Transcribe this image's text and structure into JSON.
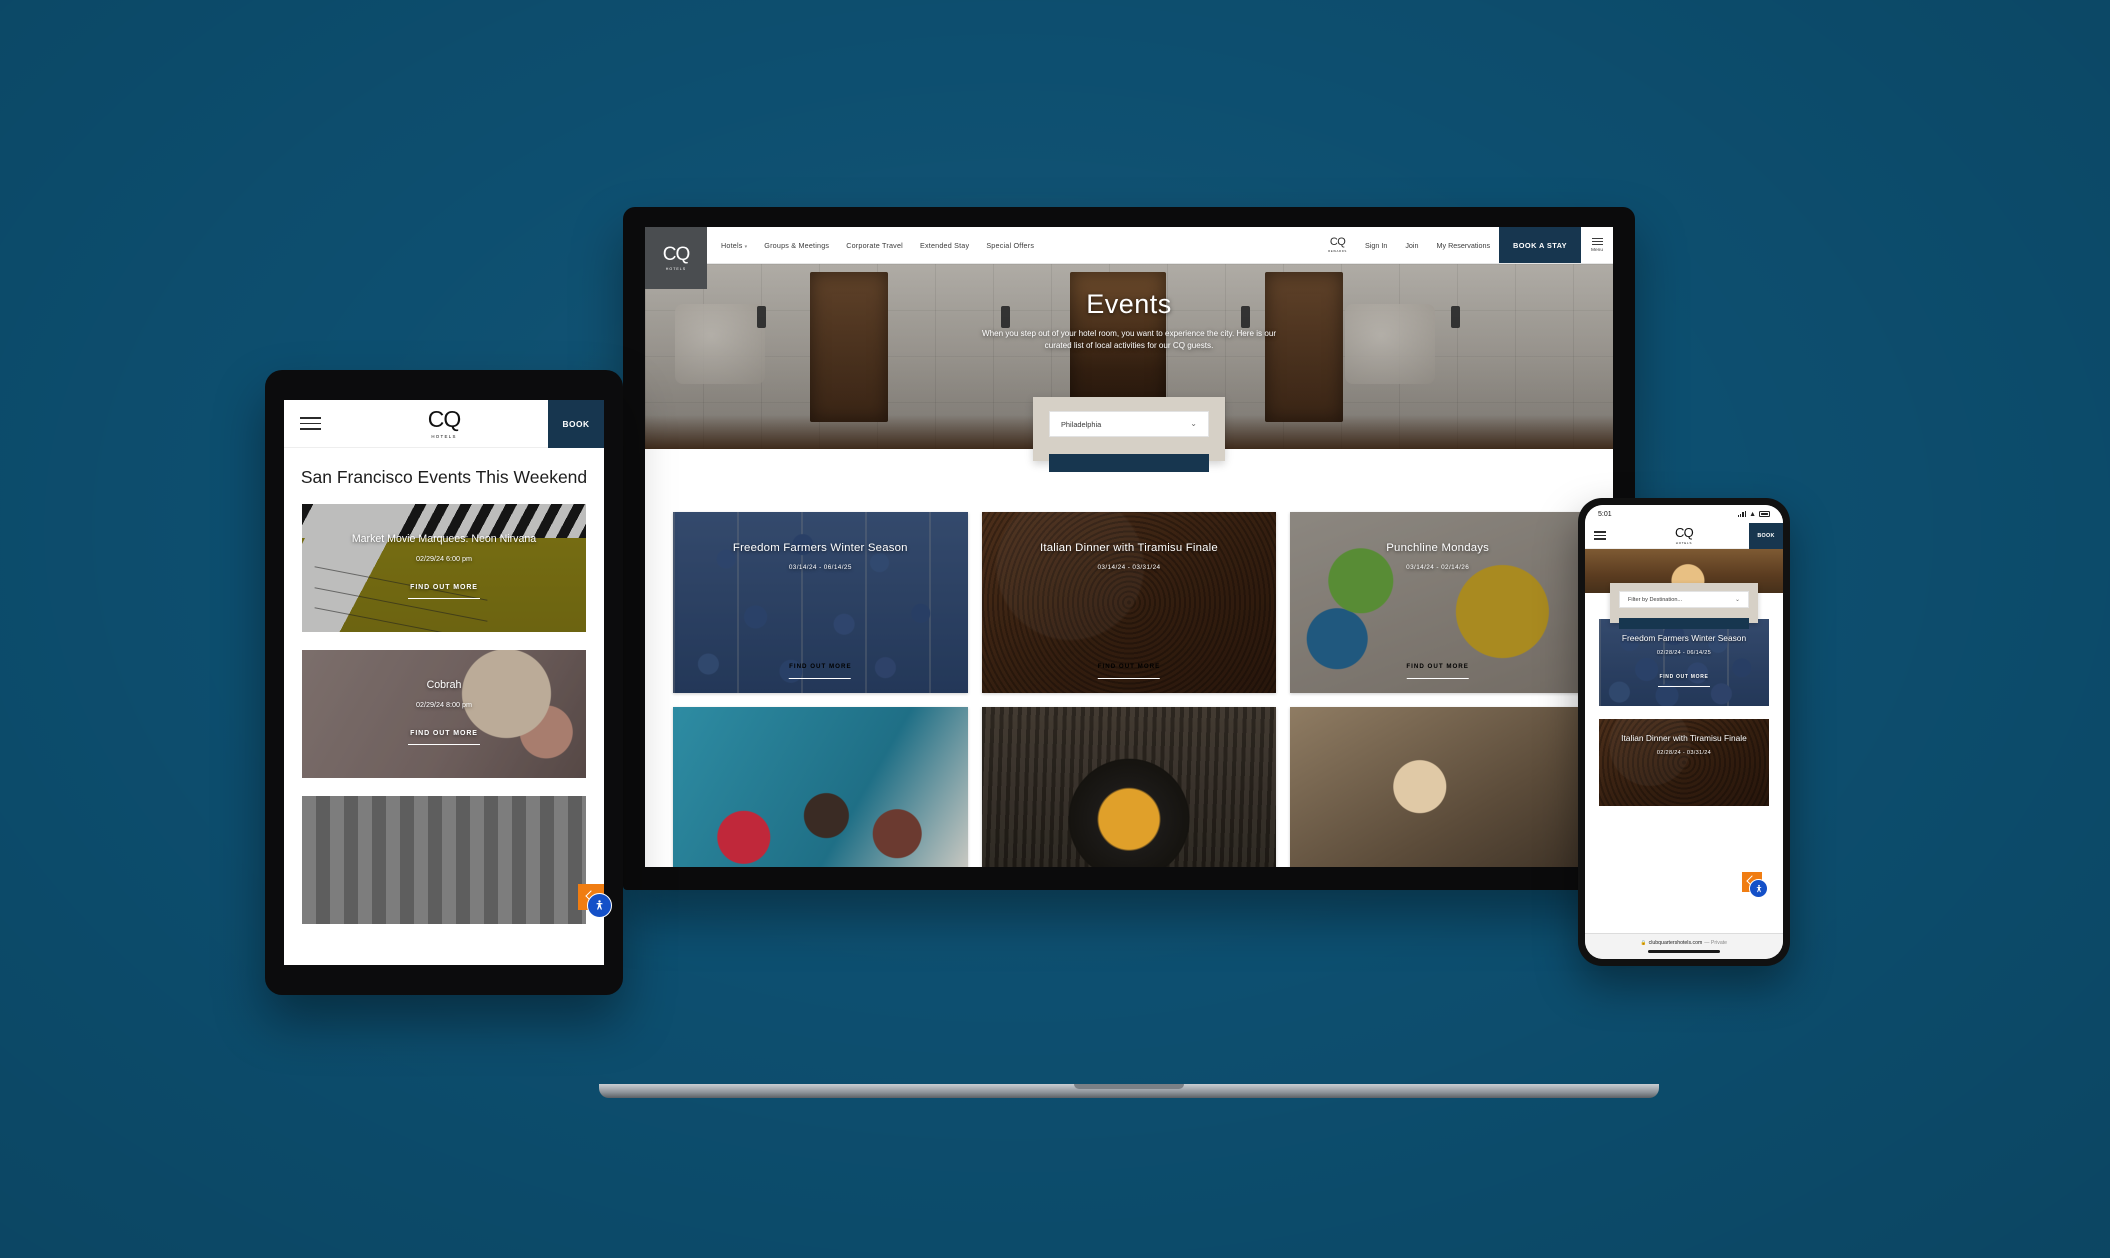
{
  "page": {
    "background_color": "#0d4f70",
    "brand_navy": "#17364f",
    "filter_card_color": "#d6d0c6",
    "accent_orange": "#f07d12",
    "a11y_blue": "#1450c8"
  },
  "desktop": {
    "logo": {
      "cq": "CQ",
      "sub": "HOTELS"
    },
    "nav_left": [
      {
        "label": "Hotels",
        "has_chevron": true
      },
      {
        "label": "Groups & Meetings",
        "has_chevron": false
      },
      {
        "label": "Corporate Travel",
        "has_chevron": false
      },
      {
        "label": "Extended Stay",
        "has_chevron": false
      },
      {
        "label": "Special Offers",
        "has_chevron": false
      }
    ],
    "rewards": {
      "cq": "CQ",
      "sub": "REWARDS"
    },
    "nav_right": [
      {
        "label": "Sign In"
      },
      {
        "label": "Join"
      },
      {
        "label": "My Reservations"
      }
    ],
    "book_button": "BOOK A STAY",
    "menu_label": "Menu",
    "hero": {
      "title": "Events",
      "subtitle": "When you step out of your hotel room, you want to experience the city. Here is our curated list of local activities for our CQ guests."
    },
    "filter": {
      "selected": "Philadelphia",
      "chevron_icon": "chevron-down-icon"
    },
    "cards": [
      {
        "title": "Freedom Farmers Winter Season",
        "date": "03/14/24 - 06/14/25",
        "cta": "FIND OUT MORE",
        "photo": "ph-blueberry"
      },
      {
        "title": "Italian Dinner with Tiramisu Finale",
        "date": "03/14/24 - 03/31/24",
        "cta": "FIND OUT MORE",
        "photo": "ph-tiramisu"
      },
      {
        "title": "Punchline Mondays",
        "date": "03/14/24 - 02/14/26",
        "cta": "FIND OUT MORE",
        "photo": "ph-punchline"
      }
    ],
    "cards_row2": [
      {
        "photo": "ph-people"
      },
      {
        "photo": "ph-pan"
      },
      {
        "photo": "ph-art"
      }
    ]
  },
  "tablet": {
    "logo": {
      "cq": "CQ",
      "sub": "HOTELS"
    },
    "book_button": "BOOK",
    "heading": "San Francisco Events This Weekend",
    "cards": [
      {
        "title": "Market Movie Marquees: Neon Nirvana",
        "date": "02/29/24 6:00 pm",
        "cta": "FIND OUT MORE",
        "photo": "ph-clapper"
      },
      {
        "title": "Cobrah",
        "date": "02/29/24 8:00 pm",
        "cta": "FIND OUT MORE",
        "photo": "ph-portrait"
      },
      {
        "title": "",
        "date": "",
        "cta": "",
        "photo": "ph-group"
      }
    ]
  },
  "phone": {
    "status": {
      "time": "5:01",
      "signal_icon": "signal-bars-icon",
      "wifi_icon": "wifi-icon",
      "battery_icon": "battery-icon"
    },
    "logo": {
      "cq": "CQ",
      "sub": "HOTELS"
    },
    "book_button": "BOOK",
    "filter": {
      "placeholder": "Filter by Destination...",
      "chevron_icon": "chevron-down-icon"
    },
    "cards": [
      {
        "title": "Freedom Farmers Winter Season",
        "date": "02/28/24 - 06/14/25",
        "cta": "FIND OUT MORE",
        "photo": "ph-blueberry"
      },
      {
        "title": "Italian Dinner with Tiramisu Finale",
        "date": "02/28/24 - 03/31/24",
        "cta": "",
        "photo": "ph-tiramisu"
      }
    ],
    "browser": {
      "lock_icon": "lock-icon",
      "url": "clubquartershotels.com",
      "privacy": "— Private"
    }
  },
  "a11y": {
    "label": "accessibility-widget",
    "glyph": "⬤"
  }
}
